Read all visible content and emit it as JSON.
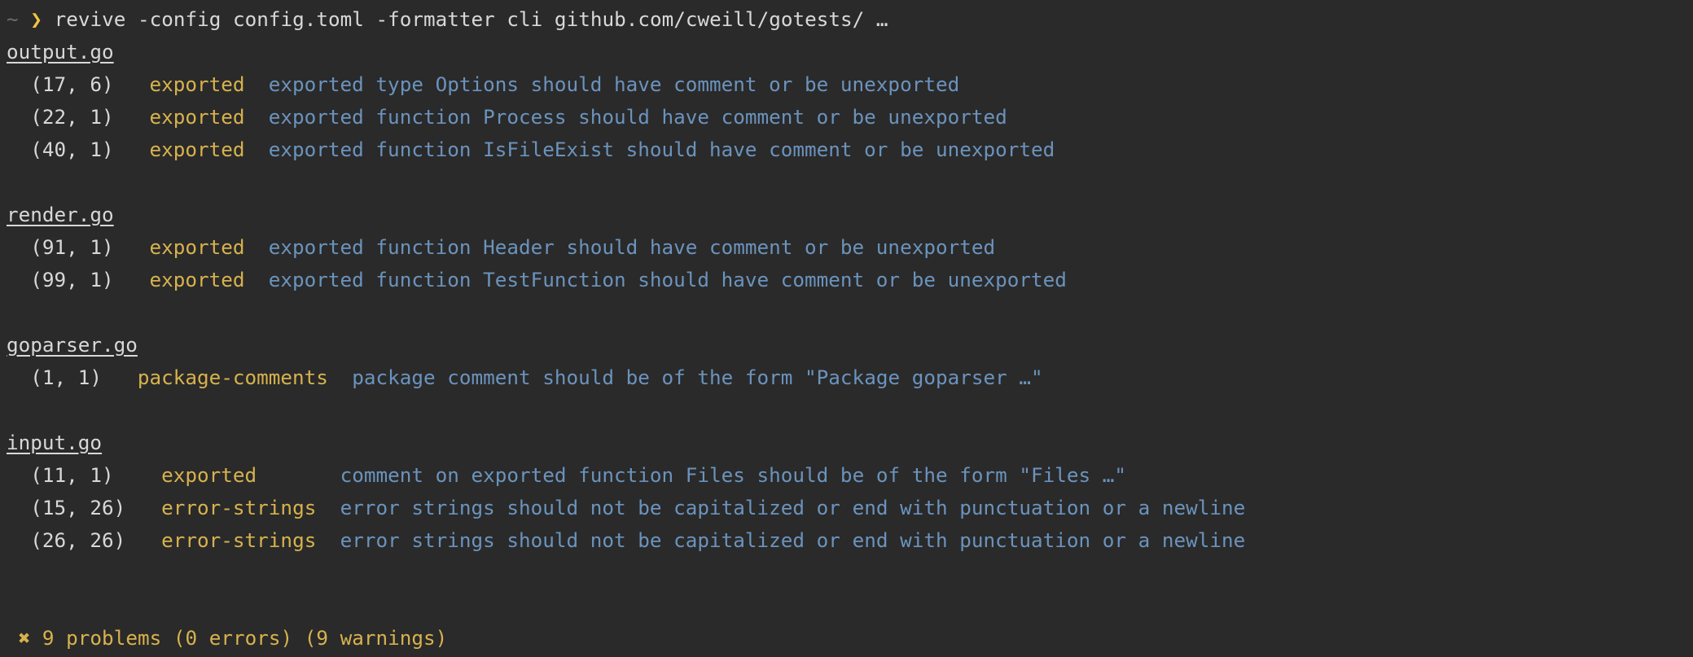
{
  "prompt": {
    "cwd": "~",
    "symbol": "❯",
    "command": "revive -config config.toml -formatter cli github.com/cweill/gotests/ …"
  },
  "groups": [
    {
      "file": "output.go",
      "issues": [
        {
          "pos": "(17, 6)",
          "rule": "exported",
          "message": "exported type Options should have comment or be unexported"
        },
        {
          "pos": "(22, 1)",
          "rule": "exported",
          "message": "exported function Process should have comment or be unexported"
        },
        {
          "pos": "(40, 1)",
          "rule": "exported",
          "message": "exported function IsFileExist should have comment or be unexported"
        }
      ]
    },
    {
      "file": "render.go",
      "issues": [
        {
          "pos": "(91, 1)",
          "rule": "exported",
          "message": "exported function Header should have comment or be unexported"
        },
        {
          "pos": "(99, 1)",
          "rule": "exported",
          "message": "exported function TestFunction should have comment or be unexported"
        }
      ]
    },
    {
      "file": "goparser.go",
      "issues": [
        {
          "pos": "(1, 1)",
          "rule": "package-comments",
          "message": "package comment should be of the form \"Package goparser …\""
        }
      ]
    },
    {
      "file": "input.go",
      "issues": [
        {
          "pos": "(11, 1)",
          "rule": "exported",
          "message": "comment on exported function Files should be of the form \"Files …\""
        },
        {
          "pos": "(15, 26)",
          "rule": "error-strings",
          "message": "error strings should not be capitalized or end with punctuation or a newline"
        },
        {
          "pos": "(26, 26)",
          "rule": "error-strings",
          "message": "error strings should not be capitalized or end with punctuation or a newline"
        }
      ]
    }
  ],
  "summary": {
    "icon": "✖",
    "text": "9 problems (0 errors) (9 warnings)"
  },
  "colors": {
    "background": "#2a2a2a",
    "rule": "#d7b24d",
    "message": "#6b93bd",
    "prompt": "#f4c542"
  }
}
